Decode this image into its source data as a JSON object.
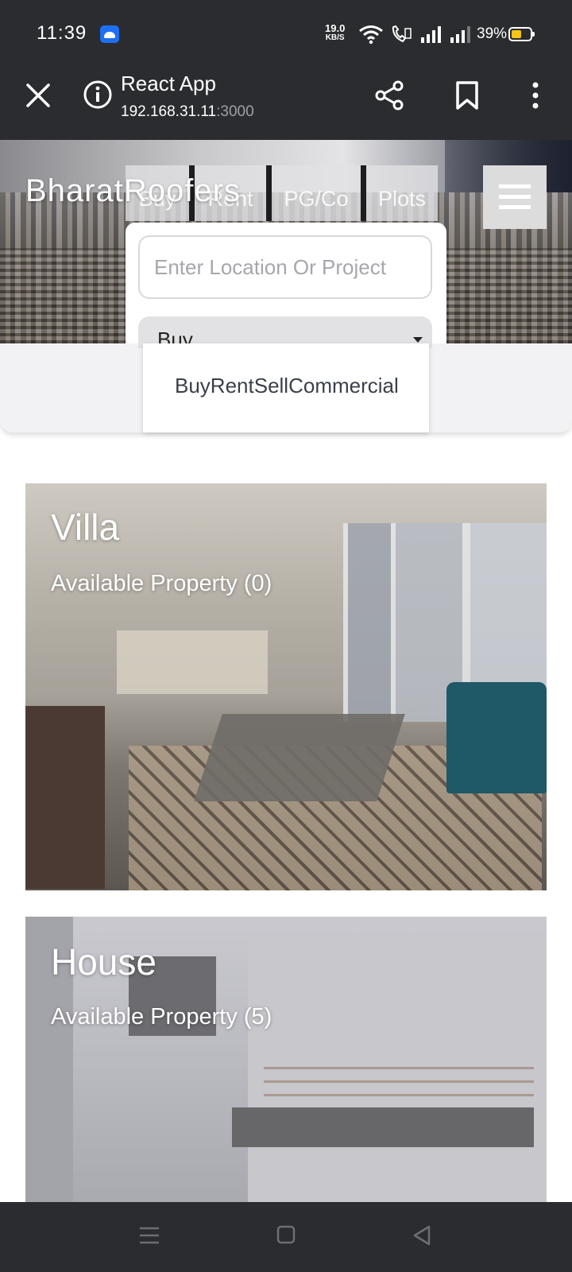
{
  "status_bar": {
    "time": "11:39",
    "net_speed_value": "19.0",
    "net_speed_unit": "KB/S",
    "battery_percent": "39%",
    "icons": [
      "android-notification-icon",
      "wifi-icon",
      "volte-call-icon",
      "signal-icon",
      "signal-icon",
      "battery-icon"
    ]
  },
  "browser": {
    "title": "React App",
    "url_host": "192.168.31.11",
    "url_port": ":3000",
    "icons": [
      "close-icon",
      "info-icon",
      "share-icon",
      "bookmark-icon",
      "more-vert-icon"
    ]
  },
  "header": {
    "brand": "BharatRoofers",
    "tabs": [
      "Buy",
      "Rent",
      "PG/Co",
      "Plots"
    ],
    "menu_icon": "hamburger-icon"
  },
  "search": {
    "placeholder": "Enter Location Or Project",
    "select_value": "Buy",
    "dropdown_options_text": "BuyRentSellCommercial"
  },
  "categories": [
    {
      "title": "Villa",
      "subtitle": "Available Property (0)"
    },
    {
      "title": "House",
      "subtitle": "Available Property (5)"
    }
  ],
  "nav_bar": {
    "icons": [
      "recent-apps-icon",
      "home-icon",
      "back-icon"
    ]
  },
  "colors": {
    "system_bar": "#2b2c2f",
    "accent_battery": "#f5c518",
    "android_badge": "#1f6ff5"
  }
}
